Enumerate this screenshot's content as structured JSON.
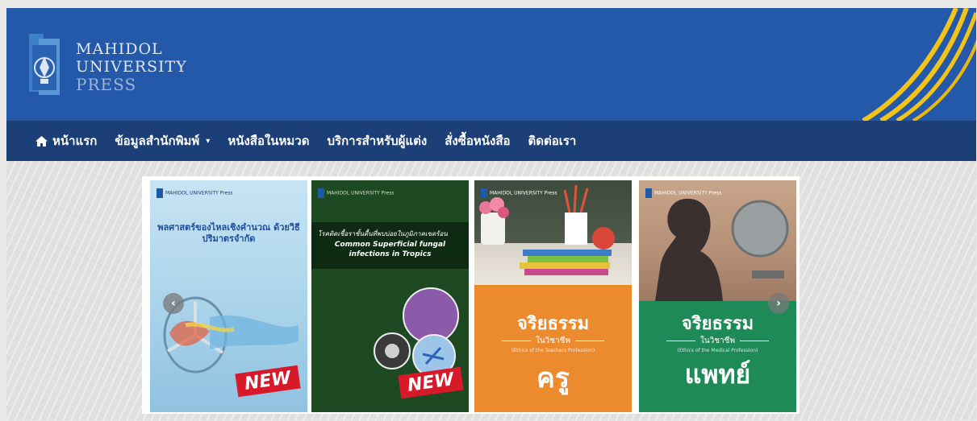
{
  "header": {
    "logo": {
      "line1": "MAHIDOL",
      "line2": "UNIVERSITY",
      "line3": "PRESS"
    },
    "colors": {
      "header_bg": "#2458a8",
      "nav_bg": "#1c3f78",
      "stripe": "#f2c318"
    }
  },
  "nav": {
    "items": [
      {
        "label": "หน้าแรก",
        "icon": "home-icon"
      },
      {
        "label": "ข้อมูลสำนักพิมพ์",
        "dropdown": true
      },
      {
        "label": "หนังสือในหมวด"
      },
      {
        "label": "บริการสำหรับผู้แต่ง"
      },
      {
        "label": "สั่งซื้อหนังสือ"
      },
      {
        "label": "ติดต่อเรา"
      }
    ],
    "caret": "▾"
  },
  "carousel": {
    "prev_icon": "chevron-left-icon",
    "next_icon": "chevron-right-icon",
    "prev_glyph": "‹",
    "next_glyph": "›",
    "covers": [
      {
        "publisher": "MAHIDOL UNIVERSITY Press",
        "title": "พลศาสตร์ของไหลเชิงคำนวณ ด้วยวิธีปริมาตรจำกัด",
        "badge": "NEW"
      },
      {
        "publisher": "MAHIDOL UNIVERSITY Press",
        "title": "โรคติดเชื้อราชั้นตื้นที่พบบ่อยในภูมิภาคเขตร้อน",
        "subtitle": "Common Superficial fungal infections in Tropics",
        "badge": "NEW"
      },
      {
        "publisher": "MAHIDOL UNIVERSITY Press",
        "title": "จริยธรรม",
        "rule_text": "ในวิชาชีพ",
        "subtitle": "(Ethics of the Teachers Profession)",
        "title2": "ครู"
      },
      {
        "publisher": "MAHIDOL UNIVERSITY Press",
        "title": "จริยธรรม",
        "rule_text": "ในวิชาชีพ",
        "subtitle": "(Ethics of the Medical Profession)",
        "title2": "แพทย์"
      }
    ]
  }
}
